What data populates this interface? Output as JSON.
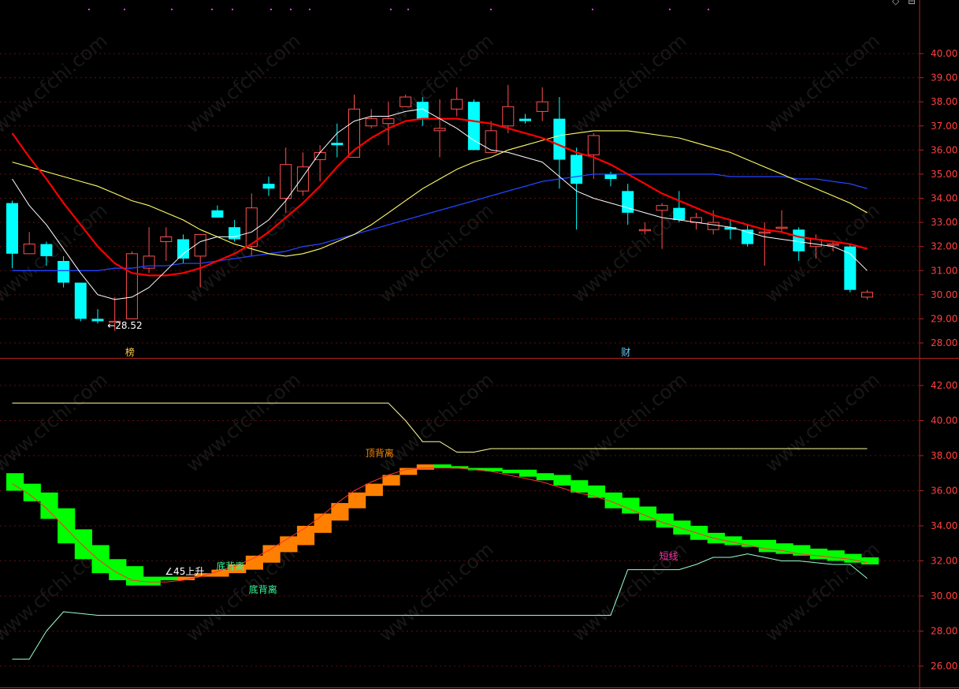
{
  "chart_data": [
    {
      "type": "candlestick",
      "panel": "price",
      "ylim": [
        27.6,
        41.6
      ],
      "yticks": [
        "28.00",
        "29.00",
        "30.00",
        "31.00",
        "32.00",
        "33.00",
        "34.00",
        "35.00",
        "36.00",
        "37.00",
        "38.00",
        "39.00",
        "40.00"
      ],
      "candles": [
        [
          33.8,
          31.7,
          31.1,
          33.9
        ],
        [
          31.7,
          32.1,
          31.7,
          32.6
        ],
        [
          32.1,
          31.6,
          31.2,
          32.2
        ],
        [
          31.4,
          30.5,
          30.3,
          31.6
        ],
        [
          30.5,
          29.0,
          28.9,
          30.5
        ],
        [
          29.0,
          28.9,
          28.8,
          29.4
        ],
        [
          28.9,
          28.9,
          28.5,
          29.9
        ],
        [
          29.0,
          31.7,
          29.0,
          31.8
        ],
        [
          31.1,
          31.6,
          30.9,
          32.8
        ],
        [
          32.2,
          32.4,
          31.4,
          32.8
        ],
        [
          32.3,
          31.5,
          31.3,
          32.5
        ],
        [
          31.6,
          32.5,
          30.3,
          32.5
        ],
        [
          33.5,
          33.2,
          33.2,
          33.7
        ],
        [
          32.8,
          32.3,
          32.2,
          33.1
        ],
        [
          32.0,
          33.6,
          31.6,
          34.2
        ],
        [
          34.6,
          34.4,
          34.1,
          34.9
        ],
        [
          34.0,
          35.4,
          33.4,
          36.1
        ],
        [
          34.3,
          35.3,
          34.1,
          35.9
        ],
        [
          35.6,
          35.9,
          34.7,
          36.2
        ],
        [
          36.3,
          36.2,
          35.7,
          37.1
        ],
        [
          35.7,
          37.7,
          35.7,
          38.3
        ],
        [
          37.0,
          37.3,
          36.9,
          37.7
        ],
        [
          37.1,
          37.3,
          36.2,
          38.0
        ],
        [
          37.8,
          38.2,
          37.8,
          38.3
        ],
        [
          38.0,
          37.3,
          37.0,
          38.2
        ],
        [
          36.8,
          36.9,
          35.7,
          38.1
        ],
        [
          37.7,
          38.1,
          37.4,
          38.6
        ],
        [
          38.0,
          36.0,
          36.0,
          38.1
        ],
        [
          35.9,
          36.8,
          35.9,
          37.2
        ],
        [
          37.0,
          37.8,
          36.7,
          38.7
        ],
        [
          37.3,
          37.2,
          37.1,
          37.5
        ],
        [
          37.6,
          38.0,
          37.2,
          38.6
        ],
        [
          37.3,
          35.6,
          34.4,
          38.2
        ],
        [
          35.8,
          34.6,
          32.7,
          36.1
        ],
        [
          35.8,
          36.6,
          34.8,
          36.7
        ],
        [
          35.0,
          34.8,
          34.5,
          35.1
        ],
        [
          34.3,
          33.4,
          32.9,
          34.6
        ],
        [
          32.7,
          32.7,
          32.5,
          33.0
        ],
        [
          33.5,
          33.7,
          31.9,
          33.8
        ],
        [
          33.6,
          33.1,
          33.0,
          34.3
        ],
        [
          33.0,
          33.2,
          32.7,
          33.4
        ],
        [
          32.7,
          33.0,
          32.5,
          33.5
        ],
        [
          32.8,
          32.7,
          32.3,
          33.1
        ],
        [
          32.7,
          32.1,
          32.0,
          32.9
        ],
        [
          32.6,
          32.6,
          31.2,
          33.0
        ],
        [
          32.8,
          32.8,
          32.6,
          33.5
        ],
        [
          32.7,
          31.8,
          31.4,
          32.8
        ],
        [
          32.0,
          32.3,
          31.5,
          32.5
        ],
        [
          32.1,
          32.1,
          31.8,
          32.2
        ],
        [
          32.0,
          30.2,
          30.1,
          32.1
        ],
        [
          29.9,
          30.1,
          29.8,
          30.2
        ]
      ],
      "ma_fast": [
        34.8,
        33.7,
        32.9,
        31.9,
        30.9,
        30.0,
        29.8,
        29.9,
        30.3,
        31.0,
        31.7,
        32.2,
        32.4,
        32.4,
        32.6,
        33.1,
        33.9,
        34.9,
        35.9,
        36.7,
        37.2,
        37.4,
        37.4,
        37.6,
        37.7,
        37.3,
        36.9,
        36.4,
        36.0,
        35.9,
        35.7,
        35.5,
        34.9,
        34.3,
        34.0,
        33.8,
        33.6,
        33.4,
        33.2,
        33.1,
        33.0,
        32.9,
        32.8,
        32.6,
        32.4,
        32.3,
        32.2,
        32.1,
        32.0,
        31.7,
        31.0
      ],
      "ma_mid": [
        36.7,
        35.7,
        34.8,
        33.8,
        32.9,
        32.0,
        31.3,
        30.9,
        30.8,
        30.8,
        30.9,
        31.1,
        31.4,
        31.7,
        32.1,
        32.6,
        33.2,
        33.8,
        34.5,
        35.3,
        36.0,
        36.5,
        36.9,
        37.2,
        37.3,
        37.3,
        37.3,
        37.2,
        37.1,
        36.9,
        36.7,
        36.5,
        36.2,
        35.9,
        35.7,
        35.4,
        35.0,
        34.6,
        34.2,
        33.9,
        33.6,
        33.3,
        33.1,
        32.9,
        32.7,
        32.6,
        32.4,
        32.3,
        32.2,
        32.1,
        31.9
      ],
      "ma_slow": [
        35.5,
        35.3,
        35.1,
        34.9,
        34.7,
        34.5,
        34.2,
        33.9,
        33.7,
        33.4,
        33.1,
        32.7,
        32.4,
        32.1,
        31.9,
        31.7,
        31.6,
        31.7,
        31.9,
        32.2,
        32.5,
        32.9,
        33.4,
        33.9,
        34.4,
        34.8,
        35.2,
        35.5,
        35.7,
        36.0,
        36.2,
        36.4,
        36.6,
        36.7,
        36.8,
        36.8,
        36.8,
        36.7,
        36.6,
        36.5,
        36.3,
        36.1,
        35.9,
        35.6,
        35.3,
        35.0,
        34.7,
        34.4,
        34.1,
        33.8,
        33.4
      ],
      "ma_long": [
        31.0,
        31.0,
        31.0,
        31.0,
        31.0,
        31.0,
        31.1,
        31.1,
        31.2,
        31.2,
        31.3,
        31.3,
        31.4,
        31.5,
        31.6,
        31.7,
        31.8,
        32.0,
        32.1,
        32.3,
        32.5,
        32.7,
        32.9,
        33.1,
        33.3,
        33.5,
        33.7,
        33.9,
        34.1,
        34.3,
        34.5,
        34.7,
        34.8,
        34.9,
        35.0,
        35.0,
        35.0,
        35.0,
        35.0,
        35.0,
        35.0,
        35.0,
        34.9,
        34.9,
        34.9,
        34.9,
        34.8,
        34.8,
        34.7,
        34.6,
        34.4
      ],
      "annotations": [
        {
          "text": "←28.52",
          "index": 6,
          "value": 28.52
        },
        {
          "text": "榜",
          "index": 7
        },
        {
          "text": "财",
          "index": 36
        }
      ]
    },
    {
      "type": "indicator",
      "panel": "indicator",
      "ylim": [
        25.2,
        43.6
      ],
      "yticks": [
        "26.00",
        "28.00",
        "30.00",
        "32.00",
        "34.00",
        "36.00",
        "38.00",
        "40.00",
        "42.00"
      ],
      "upper_band": [
        41.0,
        41.0,
        41.0,
        41.0,
        41.0,
        41.0,
        41.0,
        41.0,
        41.0,
        41.0,
        41.0,
        41.0,
        41.0,
        41.0,
        41.0,
        41.0,
        41.0,
        41.0,
        41.0,
        41.0,
        41.0,
        41.0,
        41.0,
        40.0,
        38.8,
        38.8,
        38.2,
        38.2,
        38.4,
        38.4,
        38.4,
        38.4,
        38.4,
        38.4,
        38.4,
        38.4,
        38.4,
        38.4,
        38.4,
        38.4,
        38.4,
        38.4,
        38.4,
        38.4,
        38.4,
        38.4,
        38.4,
        38.4,
        38.4,
        38.4,
        38.4
      ],
      "lower_band": [
        26.4,
        26.4,
        28.0,
        29.1,
        29.0,
        28.9,
        28.9,
        28.9,
        28.9,
        28.9,
        28.9,
        28.9,
        28.9,
        28.9,
        28.9,
        28.9,
        28.9,
        28.9,
        28.9,
        28.9,
        28.9,
        28.9,
        28.9,
        28.9,
        28.9,
        28.9,
        28.9,
        28.9,
        28.9,
        28.9,
        28.9,
        28.9,
        28.9,
        28.9,
        28.9,
        28.9,
        31.5,
        31.5,
        31.5,
        31.5,
        31.8,
        32.2,
        32.2,
        32.4,
        32.2,
        32.0,
        32.0,
        31.9,
        31.8,
        31.8,
        31.0
      ],
      "line_trend": [
        36.4,
        35.8,
        35.0,
        34.0,
        33.0,
        32.1,
        31.4,
        30.9,
        30.8,
        30.8,
        30.9,
        31.1,
        31.4,
        31.7,
        32.1,
        32.6,
        33.2,
        33.8,
        34.5,
        35.3,
        36.0,
        36.5,
        36.9,
        37.2,
        37.3,
        37.3,
        37.3,
        37.2,
        37.1,
        36.9,
        36.7,
        36.5,
        36.2,
        35.9,
        35.7,
        35.4,
        35.0,
        34.6,
        34.2,
        33.9,
        33.6,
        33.3,
        33.1,
        32.9,
        32.7,
        32.6,
        32.4,
        32.3,
        32.2,
        32.1,
        31.9
      ],
      "bars": [
        [
          37.0,
          36.0
        ],
        [
          36.4,
          35.4
        ],
        [
          35.9,
          34.4
        ],
        [
          35.0,
          33.0
        ],
        [
          33.8,
          32.1
        ],
        [
          32.9,
          31.3
        ],
        [
          32.1,
          30.9
        ],
        [
          31.7,
          30.6
        ],
        [
          31.1,
          30.6
        ],
        [
          31.1,
          30.9
        ],
        [
          30.9,
          31.1
        ],
        [
          31.1,
          31.3
        ],
        [
          31.1,
          31.5
        ],
        [
          31.3,
          31.8
        ],
        [
          31.5,
          32.3
        ],
        [
          31.9,
          32.9
        ],
        [
          32.5,
          33.4
        ],
        [
          32.9,
          34.0
        ],
        [
          33.6,
          34.7
        ],
        [
          34.3,
          35.3
        ],
        [
          35.0,
          35.9
        ],
        [
          35.7,
          36.4
        ],
        [
          36.3,
          36.9
        ],
        [
          36.9,
          37.3
        ],
        [
          37.2,
          37.5
        ],
        [
          37.5,
          37.3
        ],
        [
          37.4,
          37.3
        ],
        [
          37.3,
          37.2
        ],
        [
          37.3,
          37.1
        ],
        [
          37.2,
          37.0
        ],
        [
          37.2,
          36.8
        ],
        [
          37.0,
          36.6
        ],
        [
          36.9,
          36.3
        ],
        [
          36.6,
          35.9
        ],
        [
          36.3,
          35.6
        ],
        [
          35.9,
          35.0
        ],
        [
          35.6,
          34.7
        ],
        [
          35.1,
          34.3
        ],
        [
          34.7,
          33.9
        ],
        [
          34.3,
          33.5
        ],
        [
          34.0,
          33.2
        ],
        [
          33.6,
          33.0
        ],
        [
          33.4,
          32.9
        ],
        [
          33.2,
          32.8
        ],
        [
          33.2,
          32.5
        ],
        [
          33.0,
          32.4
        ],
        [
          32.9,
          32.3
        ],
        [
          32.7,
          32.1
        ],
        [
          32.6,
          32.0
        ],
        [
          32.4,
          31.9
        ],
        [
          32.2,
          31.8
        ]
      ],
      "annotations": [
        {
          "text": "顶背离",
          "index": 21,
          "value": 38.4
        },
        {
          "text": "∠45上升",
          "index": 9,
          "value": 31.3
        },
        {
          "text": "底背离",
          "index": 12,
          "value": 31.6
        },
        {
          "text": "底背离",
          "index": 14,
          "value": 31.0
        },
        {
          "text": "短线",
          "index": 38,
          "value": 32.1
        }
      ]
    }
  ],
  "watermark": "www.cfchi.com",
  "colors": {
    "bg": "#000000",
    "up": "#ff4f4f",
    "down": "#00ffff",
    "ma_fast": "#ffffff",
    "ma_mid": "#ff0000",
    "ma_slow": "#ffff66",
    "ma_long": "#2244ff",
    "axis": "#b22222",
    "tick": "#ff4040",
    "grid": "#5a1010",
    "bar_up": "#ff8000",
    "bar_down": "#00ff00",
    "upper_band": "#ffff99",
    "lower_band": "#99ffcc",
    "trend_line": "#ff3030",
    "label_top": "#ff8c00",
    "label_green": "#33ff99",
    "label_white": "#ffffff",
    "label_pink": "#ff33aa",
    "label_bottom_mark": "#ffcc44",
    "label_cai": "#66ccff",
    "watermark": "#ffffff"
  },
  "icons": [
    "diamond-icon",
    "lock-icon"
  ]
}
